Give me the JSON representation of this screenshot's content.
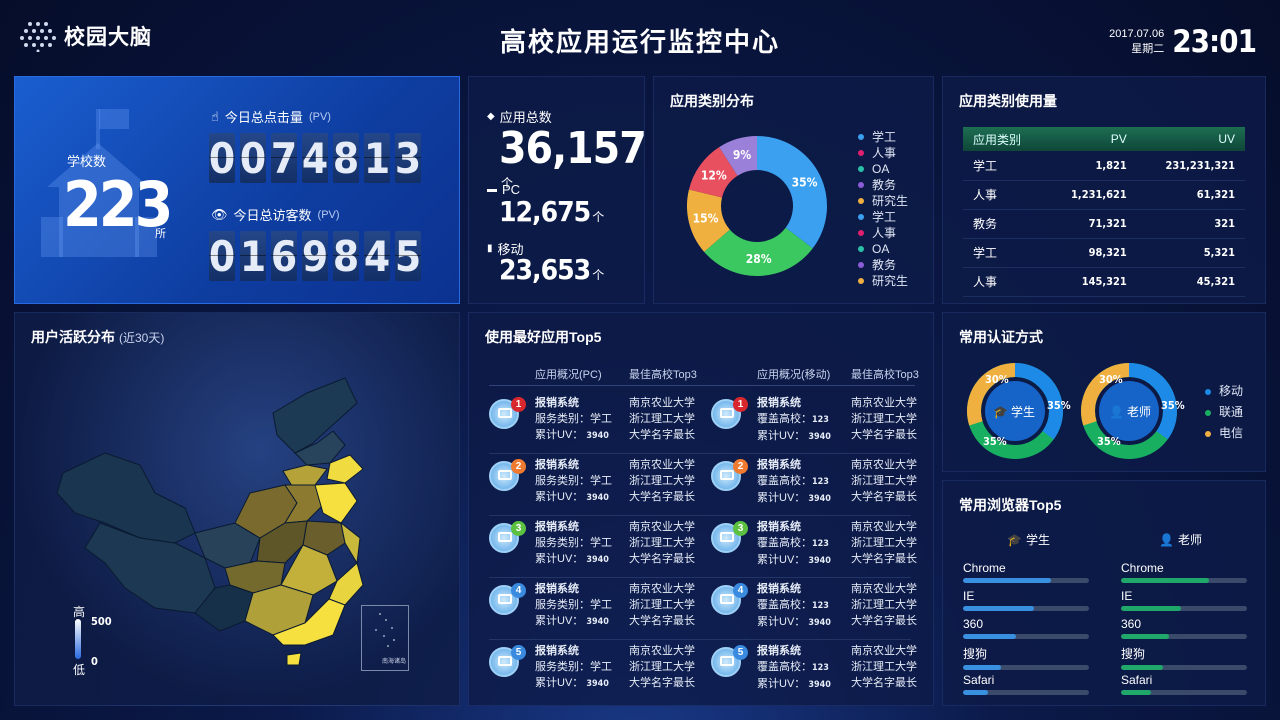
{
  "header": {
    "logo_text": "校园大脑",
    "title": "高校应用运行监控中心",
    "date": "2017.07.06",
    "weekday": "星期二",
    "time": "23:01"
  },
  "stats": {
    "school_label": "学校数",
    "school_count": "223",
    "school_unit": "所",
    "pv_label": "今日总点击量",
    "pv_suffix": "(PV)",
    "pv_digits": [
      "0",
      "0",
      "7",
      "4",
      "8",
      "1",
      "3"
    ],
    "uv_label": "今日总访客数",
    "uv_suffix": "(PV)",
    "uv_digits": [
      "0",
      "1",
      "6",
      "9",
      "8",
      "4",
      "5"
    ]
  },
  "apps": {
    "total_label": "应用总数",
    "total": "36,157",
    "unit": "个",
    "pc_label": "PC",
    "pc": "12,675",
    "mobile_label": "移动",
    "mobile": "23,653"
  },
  "category": {
    "title": "应用类别分布",
    "legend": [
      {
        "label": "学工",
        "color": "#3aa0ef"
      },
      {
        "label": "人事",
        "color": "#e0206e"
      },
      {
        "label": "OA",
        "color": "#2bc0a8"
      },
      {
        "label": "教务",
        "color": "#8a5cd8"
      },
      {
        "label": "研究生",
        "color": "#f0b040"
      },
      {
        "label": "学工",
        "color": "#3aa0ef"
      },
      {
        "label": "人事",
        "color": "#e0206e"
      },
      {
        "label": "OA",
        "color": "#2bc0a8"
      },
      {
        "label": "教务",
        "color": "#8a5cd8"
      },
      {
        "label": "研究生",
        "color": "#f0b040"
      }
    ]
  },
  "chart_data": {
    "type": "pie",
    "donut": true,
    "labels": [
      "35%",
      "28%",
      "15%",
      "12%",
      "9%"
    ],
    "values": [
      35,
      28,
      15,
      12,
      9
    ],
    "colors": [
      "#3aa0ef",
      "#3cc860",
      "#f0b040",
      "#e85060",
      "#9a80d8"
    ]
  },
  "usage": {
    "title": "应用类别使用量",
    "headers": [
      "应用类别",
      "PV",
      "UV"
    ],
    "rows": [
      [
        "学工",
        "1,821",
        "231,231,321"
      ],
      [
        "人事",
        "1,231,621",
        "61,321"
      ],
      [
        "教务",
        "71,321",
        "321"
      ],
      [
        "学工",
        "98,321",
        "5,321"
      ],
      [
        "人事",
        "145,321",
        "45,321"
      ]
    ]
  },
  "activity": {
    "title": "用户活跃分布",
    "subtitle": "(近30天)",
    "legend_high": "高",
    "legend_low": "低",
    "legend_max": "500",
    "legend_min": "0",
    "islands": "南海诸岛"
  },
  "top5": {
    "title": "使用最好应用Top5",
    "h_pc": "应用概况(PC)",
    "h_top3_1": "最佳高校Top3",
    "h_mobile": "应用概况(移动)",
    "h_top3_2": "最佳高校Top3",
    "rows": [
      {
        "rank": "1",
        "color": "#d8282e",
        "name": "报销系统",
        "svc": "服务类别：学工",
        "uv_label": "累计UV：",
        "uv": "3940",
        "s1": "南京农业大学",
        "s2": "浙江理工大学",
        "s3": "大学名字最长",
        "m_name": "报销系统",
        "m_cov": "覆盖高校：",
        "m_cov_v": "123",
        "m_uv_label": "累计UV：",
        "m_uv": "3940"
      },
      {
        "rank": "2",
        "color": "#f07a30",
        "name": "报销系统",
        "svc": "服务类别：学工",
        "uv_label": "累计UV：",
        "uv": "3940",
        "s1": "南京农业大学",
        "s2": "浙江理工大学",
        "s3": "大学名字最长",
        "m_name": "报销系统",
        "m_cov": "覆盖高校：",
        "m_cov_v": "123",
        "m_uv_label": "累计UV：",
        "m_uv": "3940"
      },
      {
        "rank": "3",
        "color": "#5cc040",
        "name": "报销系统",
        "svc": "服务类别：学工",
        "uv_label": "累计UV：",
        "uv": "3940",
        "s1": "南京农业大学",
        "s2": "浙江理工大学",
        "s3": "大学名字最长",
        "m_name": "报销系统",
        "m_cov": "覆盖高校：",
        "m_cov_v": "123",
        "m_uv_label": "累计UV：",
        "m_uv": "3940"
      },
      {
        "rank": "4",
        "color": "#3a8ae0",
        "name": "报销系统",
        "svc": "服务类别：学工",
        "uv_label": "累计UV：",
        "uv": "3940",
        "s1": "南京农业大学",
        "s2": "浙江理工大学",
        "s3": "大学名字最长",
        "m_name": "报销系统",
        "m_cov": "覆盖高校：",
        "m_cov_v": "123",
        "m_uv_label": "累计UV：",
        "m_uv": "3940"
      },
      {
        "rank": "5",
        "color": "#3a8ae0",
        "name": "报销系统",
        "svc": "服务类别：学工",
        "uv_label": "累计UV：",
        "uv": "3940",
        "s1": "南京农业大学",
        "s2": "浙江理工大学",
        "s3": "大学名字最长",
        "m_name": "报销系统",
        "m_cov": "覆盖高校：",
        "m_cov_v": "123",
        "m_uv_label": "累计UV：",
        "m_uv": "3940"
      }
    ]
  },
  "auth": {
    "title": "常用认证方式",
    "student": "学生",
    "teacher": "老师",
    "legend": [
      {
        "label": "移动",
        "color": "#1e8ae8"
      },
      {
        "label": "联通",
        "color": "#18b060"
      },
      {
        "label": "电信",
        "color": "#f0b040"
      }
    ],
    "student_pct": {
      "mobile": "35%",
      "unicom": "35%",
      "telecom": "30%"
    },
    "teacher_pct": {
      "mobile": "35%",
      "unicom": "35%",
      "telecom": "30%"
    }
  },
  "browsers": {
    "title": "常用浏览器Top5",
    "student": "学生",
    "teacher": "老师",
    "student_items": [
      {
        "name": "Chrome",
        "level": 0.7
      },
      {
        "name": "IE",
        "level": 0.56
      },
      {
        "name": "360",
        "level": 0.42
      },
      {
        "name": "搜狗",
        "level": 0.3
      },
      {
        "name": "Safari",
        "level": 0.2
      }
    ],
    "teacher_items": [
      {
        "name": "Chrome",
        "level": 0.7
      },
      {
        "name": "IE",
        "level": 0.48
      },
      {
        "name": "360",
        "level": 0.38
      },
      {
        "name": "搜狗",
        "level": 0.33
      },
      {
        "name": "Safari",
        "level": 0.24
      }
    ],
    "student_color": "#3a90e0",
    "teacher_color": "#1fa86a"
  }
}
